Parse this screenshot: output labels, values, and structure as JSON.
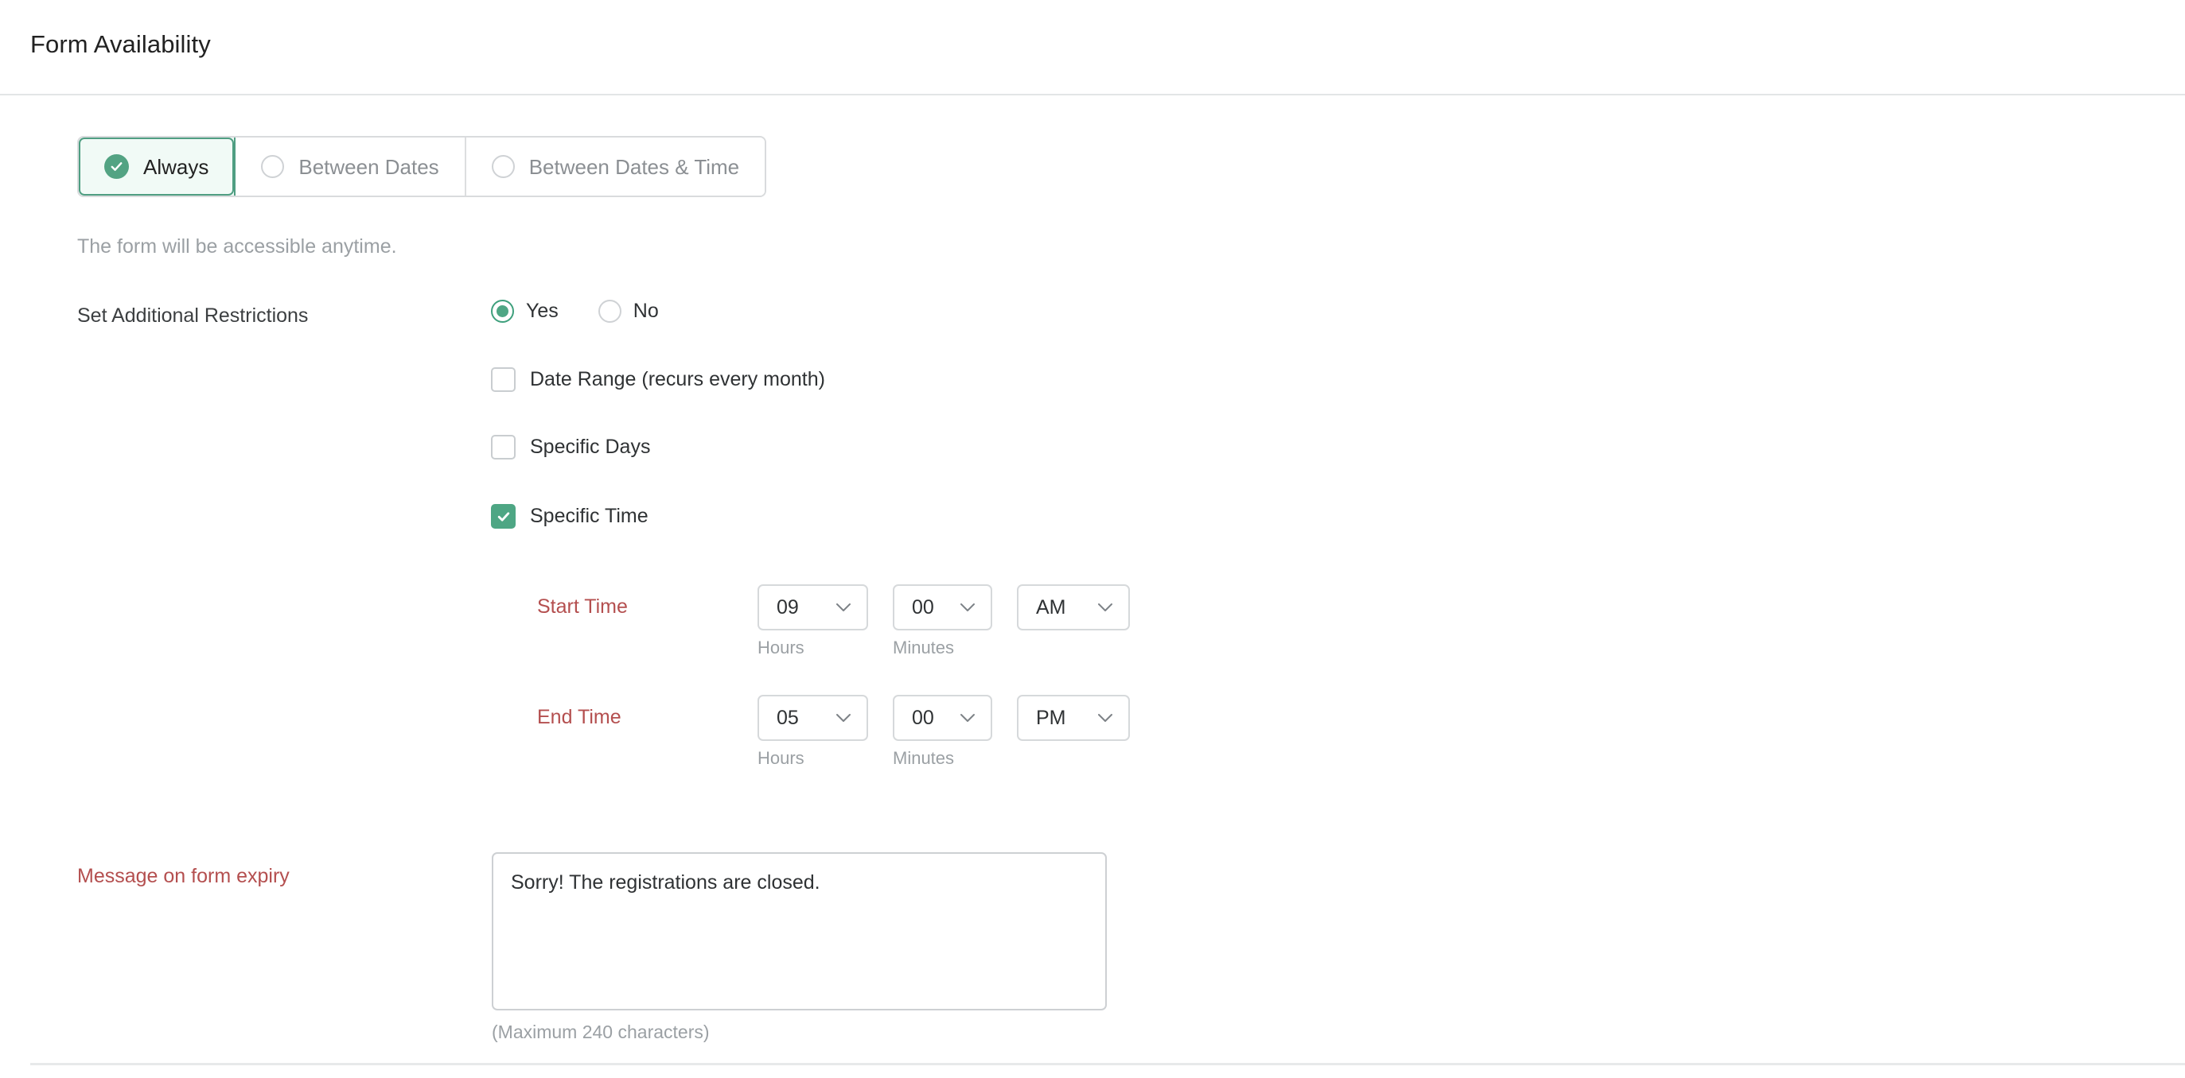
{
  "header": {
    "title": "Form Availability"
  },
  "availability_tabs": {
    "selected_index": 0,
    "items": [
      {
        "label": "Always",
        "selected": true,
        "icon": "check-circle-icon"
      },
      {
        "label": "Between Dates",
        "selected": false,
        "icon": "radio-circle-icon"
      },
      {
        "label": "Between Dates & Time",
        "selected": false,
        "icon": "radio-circle-icon"
      }
    ]
  },
  "hint": {
    "text": "The form will be accessible anytime."
  },
  "restrictions": {
    "label": "Set Additional Restrictions",
    "options": [
      {
        "label": "Yes",
        "selected": true
      },
      {
        "label": "No",
        "selected": false
      }
    ],
    "checkboxes": [
      {
        "label": "Date Range (recurs every month)",
        "checked": false
      },
      {
        "label": "Specific Days",
        "checked": false
      },
      {
        "label": "Specific Time",
        "checked": true
      }
    ]
  },
  "time_settings": {
    "start": {
      "label": "Start Time",
      "hours": {
        "value": "09",
        "sub_label": "Hours"
      },
      "minutes": {
        "value": "00",
        "sub_label": "Minutes"
      },
      "meridiem": {
        "value": "AM"
      }
    },
    "end": {
      "label": "End Time",
      "hours": {
        "value": "05",
        "sub_label": "Hours"
      },
      "minutes": {
        "value": "00",
        "sub_label": "Minutes"
      },
      "meridiem": {
        "value": "PM"
      }
    }
  },
  "expiry": {
    "label": "Message on form expiry",
    "value": "Sorry! The registrations are closed.",
    "placeholder": "",
    "char_hint": "(Maximum 240 characters)"
  },
  "colors": {
    "accent_green": "#4ea684",
    "accent_green_border": "#4f9e82",
    "selected_tab_bg": "#f1faf6",
    "required_red": "#b44f4f",
    "muted_text": "#9ba0a4",
    "border_grey": "#d6d9db"
  }
}
